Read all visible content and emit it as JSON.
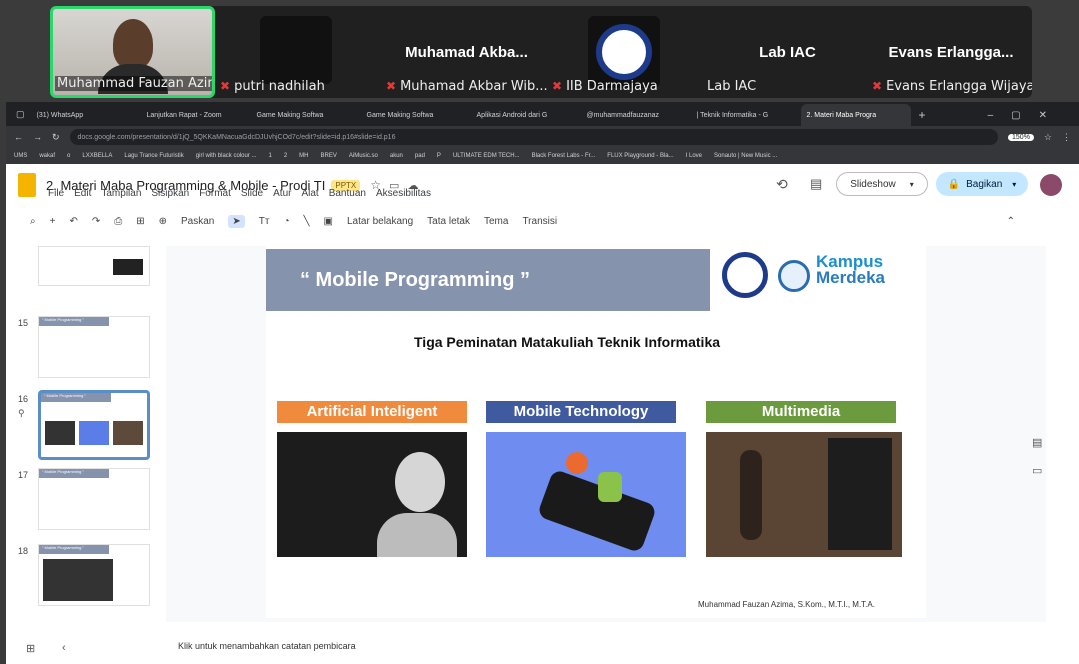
{
  "zoom": {
    "tiles": [
      {
        "name": "Muhammad Fauzan Azima",
        "big": ""
      },
      {
        "name": "putri nadhilah",
        "big": ""
      },
      {
        "name": "Muhamad Akbar Wib...",
        "big": "Muhamad Akba..."
      },
      {
        "name": "IIB Darmajaya",
        "big": ""
      },
      {
        "name": "Lab IAC",
        "big": "Lab IAC"
      },
      {
        "name": "Evans Erlangga Wijaya",
        "big": "Evans Erlangga..."
      }
    ]
  },
  "browser": {
    "tabs": [
      "(31) WhatsApp",
      "Lanjutkan Rapat - Zoom",
      "Game Making Softwa",
      "Game Making Softwa",
      "Aplikasi Android dari G",
      "@muhammadfauzanaz",
      "| Teknik Informatika - G",
      "2. Materi Maba Progra"
    ],
    "url": "docs.google.com/presentation/d/1jQ_5QKKaMNacuaGdcDJUvhjCOd7c/edit?slide=id.p16#slide=id.p16",
    "zoom_level": "150%",
    "bookmarks": [
      "UMS",
      "wakaf",
      "o",
      "LXXBELLA",
      "Lagu Trance Futuristik",
      "girl with black colour ...",
      "1",
      "2",
      "MH",
      "BREV",
      "AiMusic.so",
      "akun",
      "pad",
      "P",
      "ULTIMATE EDM TECH...",
      "Black Forest Labs - Fr...",
      "FLUX Playground - Bla...",
      "I Love",
      "Sonauto | New Music ..."
    ]
  },
  "slides_app": {
    "title": "2. Materi Maba Programming & Mobile - Prodi TI",
    "badge": "PPTX",
    "menu": [
      "File",
      "Edit",
      "Tampilan",
      "Sisipkan",
      "Format",
      "Slide",
      "Atur",
      "Alat",
      "Bantuan",
      "Aksesibilitas"
    ],
    "slideshow_label": "Slideshow",
    "share_label": "Bagikan",
    "toolbar": {
      "zoom": "Paskan",
      "background": "Latar belakang",
      "layout": "Tata letak",
      "theme": "Tema",
      "transition": "Transisi"
    },
    "thumb_numbers": [
      "15",
      "16",
      "17",
      "18"
    ],
    "thumb_titles": [
      "“ Mobile Programming ”",
      "“ Mobile Programming ”",
      "“ Mobile Programming ”",
      "“ Mobile Programming ”"
    ],
    "notes_placeholder": "Klik untuk menambahkan catatan pembicara"
  },
  "slide": {
    "banner": "“ Mobile Programming ”",
    "subtitle": "Tiga Peminatan Matakuliah Teknik Informatika",
    "kampus": "Kampus",
    "merdeka": "Merdeka",
    "categories": [
      {
        "label": "Artificial Inteligent",
        "color": "#f08a3c"
      },
      {
        "label": "Mobile Technology",
        "color": "#3f5a9e"
      },
      {
        "label": "Multimedia",
        "color": "#6c9a3e"
      }
    ],
    "author": "Muhammad Fauzan Azima, S.Kom., M.T.I., M.T.A."
  }
}
